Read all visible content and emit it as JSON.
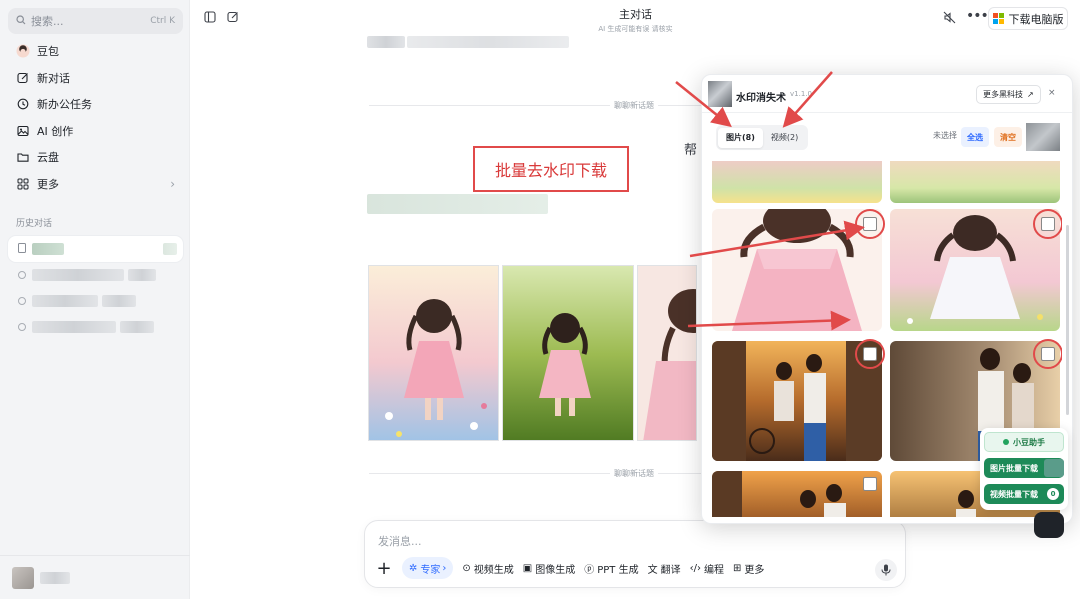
{
  "sidebar": {
    "search_placeholder": "搜索...",
    "search_shortcut": "Ctrl K",
    "items": [
      {
        "label": "豆包",
        "icon": "doubao-avatar-icon"
      },
      {
        "label": "新对话",
        "icon": "edit-icon"
      },
      {
        "label": "新办公任务",
        "icon": "office-task-icon"
      },
      {
        "label": "AI 创作",
        "icon": "image-icon"
      },
      {
        "label": "云盘",
        "icon": "folder-icon"
      },
      {
        "label": "更多",
        "icon": "grid-icon"
      }
    ],
    "history_label": "历史对话"
  },
  "header": {
    "title": "主对话",
    "subtitle": "AI 生成可能有误 请核实",
    "download_label": "下载电脑版"
  },
  "chat": {
    "divider_label": "聊聊新话题",
    "annotation": "批量去水印下载",
    "partial_text": "帮"
  },
  "input": {
    "placeholder": "发消息...",
    "tools": [
      {
        "label": "专家",
        "icon": "expert-icon"
      },
      {
        "label": "视频生成",
        "icon": "video-icon"
      },
      {
        "label": "图像生成",
        "icon": "image-gen-icon"
      },
      {
        "label": "PPT 生成",
        "icon": "ppt-icon"
      },
      {
        "label": "翻译",
        "icon": "translate-icon"
      },
      {
        "label": "编程",
        "icon": "code-icon"
      },
      {
        "label": "更多",
        "icon": "grid-icon"
      }
    ]
  },
  "panel": {
    "title": "水印消失术",
    "version": "v1.1.0",
    "more_tech": "更多黑科技",
    "close": "×",
    "tabs": [
      {
        "label": "图片(8)",
        "active": true
      },
      {
        "label": "视频(2)",
        "active": false
      }
    ],
    "unselected": "未选择",
    "select_all": "全选",
    "clear": "清空"
  },
  "helper": {
    "title": "小豆助手",
    "batch_image": "图片批量下载",
    "batch_video": "视频批量下载",
    "video_count": "0"
  },
  "colors": {
    "accent": "#2f6bff",
    "annotation_red": "#e14a4a",
    "helper_green": "#1d8a58"
  }
}
